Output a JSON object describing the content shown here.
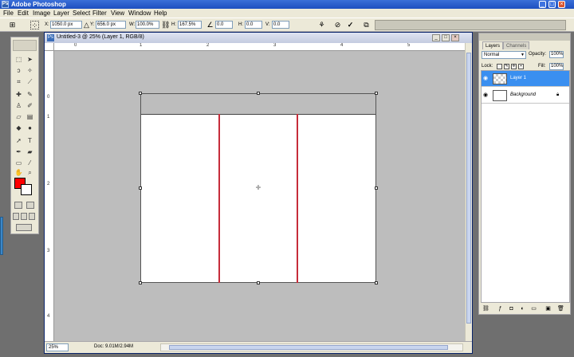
{
  "app": {
    "title": "Adobe Photoshop"
  },
  "window_buttons": [
    "_",
    "□",
    "×"
  ],
  "menu": [
    "File",
    "Edit",
    "Image",
    "Layer",
    "Select",
    "Filter",
    "View",
    "Window",
    "Help"
  ],
  "options": {
    "x_label": "X:",
    "x_value": "1050.0 px",
    "y_label": "Y:",
    "y_value": "656.0 px",
    "w_label": "W:",
    "w_value": "100.0%",
    "h_label": "H:",
    "h_value": "167.5%",
    "angle_value": "0.0",
    "hskew_label": "H:",
    "hskew_value": "0.0",
    "vskew_label": "V:",
    "vskew_value": "0.0"
  },
  "document": {
    "title": "Untitled-3 @ 25% (Layer 1, RGB/8)",
    "zoom": "25%",
    "doc_info": "Doc: 9.01M/2.94M",
    "ruler_top": [
      "0",
      "1",
      "2",
      "3",
      "4",
      "5",
      "6",
      "7",
      "8"
    ],
    "ruler_left": [
      "0",
      "1",
      "2",
      "3",
      "4",
      "5",
      "6"
    ]
  },
  "colors": {
    "foreground": "#ff0000",
    "background": "#ffffff",
    "fold_line": "#c62c3a",
    "selected_layer": "#3a8ff0"
  },
  "layers_panel": {
    "tabs": [
      "Layers",
      "Channels"
    ],
    "blend_mode": "Normal",
    "opacity_label": "Opacity:",
    "opacity_value": "100%",
    "lock_label": "Lock:",
    "fill_label": "Fill:",
    "fill_value": "100%",
    "layers": [
      {
        "name": "Layer 1",
        "selected": true
      },
      {
        "name": "Background",
        "selected": false
      }
    ]
  }
}
